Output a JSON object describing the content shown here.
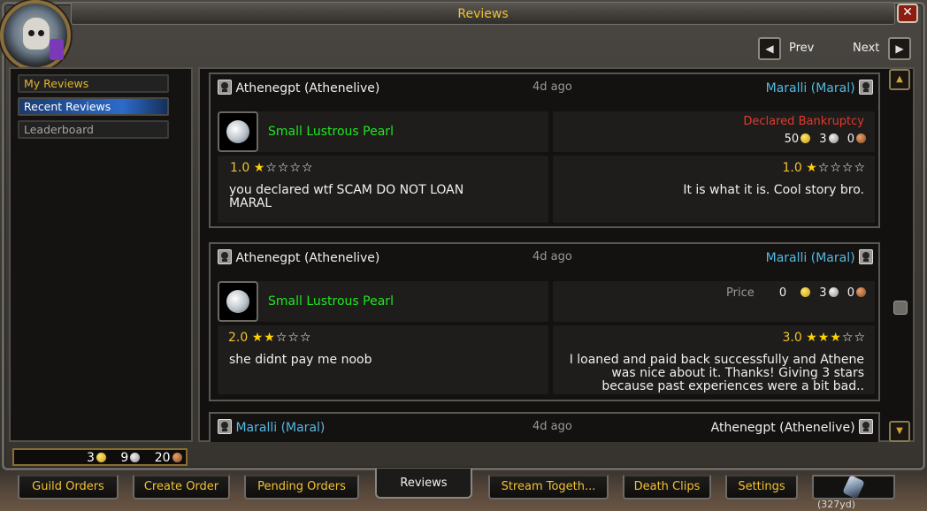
{
  "window": {
    "title": "Reviews",
    "close_label": "✕"
  },
  "nav": {
    "prev_label": "Prev",
    "next_label": "Next"
  },
  "sidebar": {
    "items": [
      {
        "label": "My Reviews"
      },
      {
        "label": "Recent Reviews",
        "selected": true
      },
      {
        "label": "Leaderboard"
      }
    ]
  },
  "currency": {
    "gold": "3",
    "silver": "9",
    "copper": "20"
  },
  "reviews": [
    {
      "author": "Athenegpt (Athenelive)",
      "time": "4d ago",
      "target": "Maralli (Maral)",
      "item": "Small Lustrous Pearl",
      "status": "Declared Bankruptcy",
      "price_label": "",
      "coins": {
        "gold": "50",
        "silver": "3",
        "copper": "0"
      },
      "left_rating": "1.0",
      "left_stars": 1,
      "left_comment_l1": "you declared wtf SCAM DO NOT LOAN",
      "left_comment_l2": "MARAL",
      "right_rating": "1.0",
      "right_stars": 1,
      "right_comment_l1": "It is what it is. Cool story bro.",
      "right_comment_l2": "",
      "right_comment_l3": ""
    },
    {
      "author": "Athenegpt (Athenelive)",
      "time": "4d ago",
      "target": "Maralli (Maral)",
      "item": "Small Lustrous Pearl",
      "status": "",
      "price_label": "Price",
      "coins": {
        "gold": "0",
        "silver": "3",
        "copper": "0"
      },
      "left_rating": "2.0",
      "left_stars": 2,
      "left_comment_l1": "she didnt pay me noob",
      "left_comment_l2": "",
      "right_rating": "3.0",
      "right_stars": 3,
      "right_comment_l1": "I loaned and paid back successfully and Athene",
      "right_comment_l2": "was nice about it. Thanks! Giving 3 stars",
      "right_comment_l3": "because past experiences were a bit bad.."
    },
    {
      "author": "Maralli (Maral)",
      "time": "4d ago",
      "target": "Athenegpt (Athenelive)"
    }
  ],
  "tabs": [
    {
      "label": "Guild Orders"
    },
    {
      "label": "Create Order"
    },
    {
      "label": "Pending Orders"
    },
    {
      "label": "Reviews",
      "active": true
    },
    {
      "label": "Stream Togeth..."
    },
    {
      "label": "Death Clips"
    },
    {
      "label": "Settings"
    }
  ],
  "distance": "(327yd)",
  "colors": {
    "gold_text": "#f2c230",
    "item_green": "#1ee81e",
    "player_blue": "#55b8e0",
    "bankruptcy_red": "#e33a2a"
  }
}
